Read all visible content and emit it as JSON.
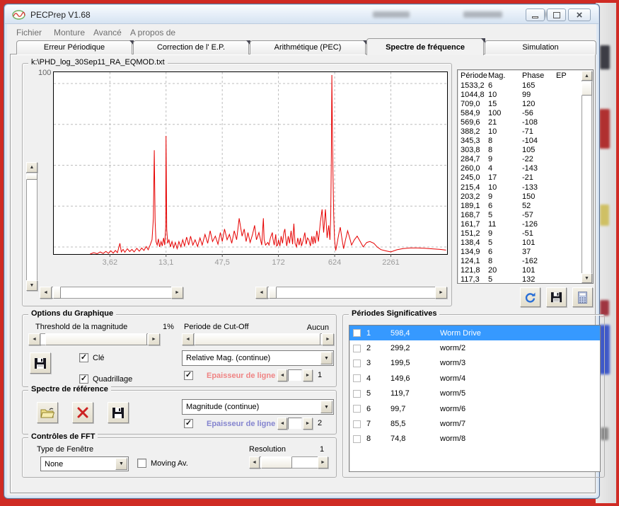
{
  "colors": {
    "selection": "#3699ff",
    "spectrum": "#e60000",
    "line_width_red": "#ef8484",
    "line_width_blue": "#8585cf"
  },
  "window": {
    "title": "PECPrep V1.68"
  },
  "menu": {
    "items": [
      "Fichier",
      "Monture",
      "Avancé",
      "A propos de"
    ]
  },
  "tabs": {
    "items": [
      "Erreur Périodique",
      "Correction de l' E.P.",
      "Arithmétique (PEC)",
      "Spectre de fréquence",
      "Simulation"
    ],
    "active_index": 3
  },
  "chart": {
    "file_label": "k:\\PHD_log_30Sep11_RA_EQMOD.txt"
  },
  "chart_data": {
    "type": "line",
    "title": "FFT magnitude spectrum",
    "xscale": "log",
    "xlim": [
      1,
      8200
    ],
    "ylim": [
      0,
      100
    ],
    "grid": true,
    "x_tick_values": [
      3.62,
      13.1,
      47.5,
      172,
      624,
      2261
    ],
    "x_tick_labels": [
      "3,62",
      "13,1",
      "47,5",
      "172",
      "624",
      "2261"
    ],
    "y_top_label": "100",
    "line_color": "#e60000",
    "main_peaks": [
      [
        584.9,
        100
      ],
      [
        13.1,
        66
      ],
      [
        10.0,
        58
      ],
      [
        569.6,
        21
      ],
      [
        121.8,
        20
      ],
      [
        245.0,
        17
      ],
      [
        709.0,
        15
      ],
      [
        99.7,
        16
      ]
    ],
    "trace": [
      [
        2.3,
        0
      ],
      [
        2.5,
        0.8
      ],
      [
        2.7,
        0.2
      ],
      [
        2.9,
        1.2
      ],
      [
        3.1,
        0.3
      ],
      [
        3.3,
        1.5
      ],
      [
        3.5,
        0.4
      ],
      [
        3.7,
        1.8
      ],
      [
        3.9,
        0.5
      ],
      [
        4.1,
        2
      ],
      [
        4.3,
        0.8
      ],
      [
        4.55,
        6
      ],
      [
        4.7,
        1.2
      ],
      [
        4.9,
        2.6
      ],
      [
        5.1,
        1
      ],
      [
        5.4,
        3
      ],
      [
        5.7,
        1.4
      ],
      [
        6,
        2.6
      ],
      [
        6.3,
        1.2
      ],
      [
        6.7,
        3.2
      ],
      [
        7.1,
        1.6
      ],
      [
        7.5,
        3.4
      ],
      [
        7.9,
        2
      ],
      [
        8.3,
        4.2
      ],
      [
        8.7,
        2.4
      ],
      [
        9.1,
        5
      ],
      [
        9.5,
        8
      ],
      [
        9.8,
        20
      ],
      [
        10,
        58
      ],
      [
        10.2,
        18
      ],
      [
        10.4,
        7
      ],
      [
        10.7,
        5
      ],
      [
        11,
        8.5
      ],
      [
        11.3,
        4
      ],
      [
        11.7,
        7
      ],
      [
        12,
        4.5
      ],
      [
        12.4,
        9
      ],
      [
        12.7,
        5
      ],
      [
        13,
        15
      ],
      [
        13.1,
        66
      ],
      [
        13.3,
        14
      ],
      [
        13.6,
        6
      ],
      [
        14,
        8
      ],
      [
        14.5,
        4
      ],
      [
        15,
        7
      ],
      [
        15.6,
        3.5
      ],
      [
        16.2,
        6.5
      ],
      [
        16.9,
        3
      ],
      [
        17.6,
        7
      ],
      [
        18.4,
        4
      ],
      [
        19.2,
        8
      ],
      [
        20,
        4.5
      ],
      [
        21,
        9.5
      ],
      [
        22,
        5
      ],
      [
        23,
        10
      ],
      [
        24.2,
        5
      ],
      [
        25.5,
        8
      ],
      [
        27,
        4.2
      ],
      [
        28.5,
        9
      ],
      [
        30,
        5
      ],
      [
        32,
        11
      ],
      [
        34,
        6
      ],
      [
        36,
        13
      ],
      [
        38,
        7
      ],
      [
        40.5,
        10
      ],
      [
        43,
        5.5
      ],
      [
        45.5,
        12
      ],
      [
        47.5,
        7
      ],
      [
        50,
        14
      ],
      [
        53,
        8
      ],
      [
        56,
        11
      ],
      [
        59,
        6
      ],
      [
        62.5,
        13
      ],
      [
        66,
        8
      ],
      [
        70,
        20
      ],
      [
        74.8,
        10
      ],
      [
        78.5,
        14
      ],
      [
        82,
        7
      ],
      [
        85.5,
        12
      ],
      [
        90,
        6.5
      ],
      [
        95,
        11
      ],
      [
        99.7,
        16
      ],
      [
        104,
        8
      ],
      [
        110,
        12
      ],
      [
        117.3,
        5
      ],
      [
        121.8,
        20
      ],
      [
        124.1,
        8
      ],
      [
        128,
        5
      ],
      [
        134.9,
        6.5
      ],
      [
        138.4,
        5
      ],
      [
        143,
        9
      ],
      [
        149.6,
        12
      ],
      [
        151.2,
        9
      ],
      [
        156,
        5
      ],
      [
        161.7,
        11
      ],
      [
        165,
        4.5
      ],
      [
        168.7,
        5
      ],
      [
        172,
        8
      ],
      [
        178,
        4.5
      ],
      [
        183,
        10
      ],
      [
        189.1,
        6
      ],
      [
        195,
        12
      ],
      [
        199.5,
        14
      ],
      [
        203.2,
        9
      ],
      [
        208,
        4.5
      ],
      [
        215.4,
        10
      ],
      [
        222,
        6
      ],
      [
        230,
        13
      ],
      [
        238,
        5.5
      ],
      [
        245,
        17
      ],
      [
        252,
        6
      ],
      [
        260,
        4
      ],
      [
        268,
        9
      ],
      [
        276,
        5
      ],
      [
        284.7,
        9
      ],
      [
        292,
        4.5
      ],
      [
        303.8,
        8
      ],
      [
        315,
        12
      ],
      [
        325,
        5.5
      ],
      [
        335,
        9
      ],
      [
        345.3,
        8
      ],
      [
        358,
        4.5
      ],
      [
        370,
        10
      ],
      [
        380,
        5.5
      ],
      [
        388.2,
        10
      ],
      [
        400,
        6
      ],
      [
        415,
        13
      ],
      [
        430,
        7
      ],
      [
        450,
        18
      ],
      [
        468,
        25
      ],
      [
        485,
        12
      ],
      [
        505,
        25
      ],
      [
        525,
        9
      ],
      [
        545,
        16
      ],
      [
        560,
        8
      ],
      [
        569.6,
        21
      ],
      [
        578,
        55
      ],
      [
        584.9,
        100
      ],
      [
        592,
        72
      ],
      [
        600,
        45
      ],
      [
        610,
        22
      ],
      [
        622,
        8
      ],
      [
        640,
        2
      ],
      [
        665,
        7
      ],
      [
        690,
        12
      ],
      [
        709,
        15
      ],
      [
        735,
        9
      ],
      [
        765,
        3
      ],
      [
        800,
        8
      ],
      [
        840,
        13
      ],
      [
        880,
        9
      ],
      [
        920,
        5
      ],
      [
        980,
        8
      ],
      [
        1044.8,
        10
      ],
      [
        1120,
        7
      ],
      [
        1200,
        4
      ],
      [
        1300,
        6.5
      ],
      [
        1400,
        7
      ],
      [
        1533.2,
        6
      ],
      [
        1650,
        4
      ],
      [
        1800,
        2.5
      ],
      [
        2000,
        1.8
      ],
      [
        2261,
        1.2
      ],
      [
        2600,
        2.4
      ],
      [
        3000,
        3.1
      ],
      [
        3500,
        3.4
      ],
      [
        4200,
        3.4
      ],
      [
        5000,
        3.2
      ],
      [
        6000,
        2.9
      ],
      [
        7000,
        2.6
      ],
      [
        8000,
        2.2
      ]
    ]
  },
  "freq_table": {
    "columns": [
      "Période",
      "Mag.",
      "Phase",
      "EP"
    ],
    "rows": [
      [
        "1533,2",
        "6",
        "165",
        ""
      ],
      [
        "1044,8",
        "10",
        "99",
        ""
      ],
      [
        "709,0",
        "15",
        "120",
        ""
      ],
      [
        "584,9",
        "100",
        "-56",
        ""
      ],
      [
        "569,6",
        "21",
        "-108",
        ""
      ],
      [
        "388,2",
        "10",
        "-71",
        ""
      ],
      [
        "345,3",
        "8",
        "-104",
        ""
      ],
      [
        "303,8",
        "8",
        "105",
        ""
      ],
      [
        "284,7",
        "9",
        "-22",
        ""
      ],
      [
        "260,0",
        "4",
        "-143",
        ""
      ],
      [
        "245,0",
        "17",
        "-21",
        ""
      ],
      [
        "215,4",
        "10",
        "-133",
        ""
      ],
      [
        "203,2",
        "9",
        "150",
        ""
      ],
      [
        "189,1",
        "6",
        "52",
        ""
      ],
      [
        "168,7",
        "5",
        "-57",
        ""
      ],
      [
        "161,7",
        "11",
        "-126",
        ""
      ],
      [
        "151,2",
        "9",
        "-51",
        ""
      ],
      [
        "138,4",
        "5",
        "101",
        ""
      ],
      [
        "134,9",
        "6",
        "37",
        ""
      ],
      [
        "124,1",
        "8",
        "-162",
        ""
      ],
      [
        "121,8",
        "20",
        "101",
        ""
      ],
      [
        "117,3",
        "5",
        "132",
        ""
      ]
    ]
  },
  "options_group": {
    "title": "Options du Graphique",
    "threshold_label": "Threshold de la magnitude",
    "threshold_value": "1%",
    "cutoff_label": "Periode de Cut-Off",
    "cutoff_value": "Aucun",
    "key_checkbox": "Clé",
    "grid_checkbox": "Quadrillage",
    "display_mode": "Relative Mag. (continue)",
    "line_width_label": "Epaisseur de ligne",
    "line_width_value": "1"
  },
  "reference_group": {
    "title": "Spectre de référence",
    "display_mode": "Magnitude (continue)",
    "line_width_label": "Epaisseur de ligne",
    "line_width_value": "2"
  },
  "fft_group": {
    "title": "Contrôles de FFT",
    "window_type_label": "Type de Fenêtre",
    "window_type_value": "None",
    "moving_av_label": "Moving Av.",
    "resolution_label": "Resolution",
    "resolution_value": "1"
  },
  "periods_group": {
    "title": "Périodes Significatives",
    "rows": [
      {
        "num": "1",
        "period": "598,4",
        "name": "Worm Drive",
        "selected": true
      },
      {
        "num": "2",
        "period": "299,2",
        "name": "worm/2",
        "selected": false
      },
      {
        "num": "3",
        "period": "199,5",
        "name": "worm/3",
        "selected": false
      },
      {
        "num": "4",
        "period": "149,6",
        "name": "worm/4",
        "selected": false
      },
      {
        "num": "5",
        "period": "119,7",
        "name": "worm/5",
        "selected": false
      },
      {
        "num": "6",
        "period": "99,7",
        "name": "worm/6",
        "selected": false
      },
      {
        "num": "7",
        "period": "85,5",
        "name": "worm/7",
        "selected": false
      },
      {
        "num": "8",
        "period": "74,8",
        "name": "worm/8",
        "selected": false
      }
    ]
  }
}
